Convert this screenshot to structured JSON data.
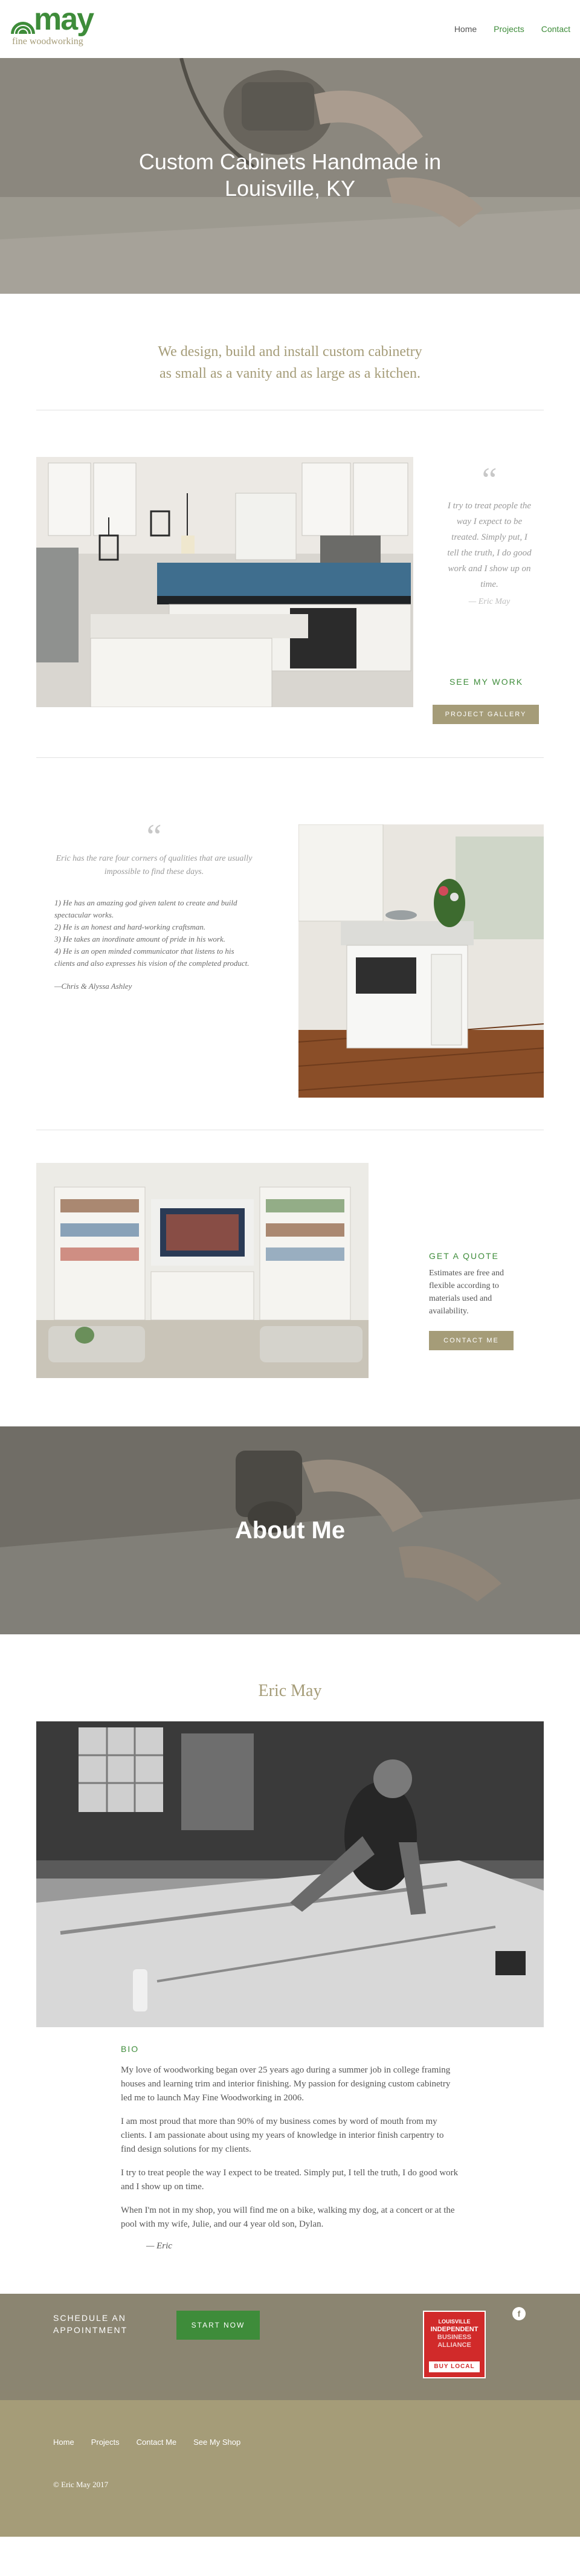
{
  "brand": {
    "name": "may",
    "subtitle": "fine woodworking",
    "green": "#3e8c3a",
    "tan": "#a59c78"
  },
  "nav": {
    "items": [
      {
        "label": "Home",
        "active": false
      },
      {
        "label": "Projects",
        "active": true
      },
      {
        "label": "Contact",
        "active": true
      }
    ]
  },
  "hero": {
    "title_line1": "Custom Cabinets Handmade in",
    "title_line2": "Louisville, KY"
  },
  "tagline": {
    "line1": "We design, build and install custom cabinetry",
    "line2": "as small as a vanity and as large as a kitchen."
  },
  "section1": {
    "quote_mark": "“",
    "quote": "I try to treat people the way I expect to be treated. Simply put, I tell the truth, I do good work and I show up on time.",
    "cite": "— Eric May",
    "link": "SEE MY WORK",
    "button": "PROJECT GALLERY"
  },
  "section2": {
    "quote_mark": "“",
    "intro": "Eric has the rare four corners of qualities that are usually impossible to find these days.",
    "points": [
      "1) He has an amazing god given talent to create and build spectacular works.",
      "2) He is an honest and hard-working craftsman.",
      "3) He takes an inordinate amount of pride in his work.",
      "4) He is an open minded communicator that listens to his clients and also expresses his vision of the completed product."
    ],
    "cite": "—Chris & Alyssa Ashley"
  },
  "section3": {
    "heading": "GET A QUOTE",
    "text": "Estimates are free and flexible according to materials used and availability.",
    "button": "CONTACT ME"
  },
  "about": {
    "banner_title": "About Me",
    "name": "Eric May",
    "bio_label": "BIO",
    "paragraphs": [
      "My love of woodworking began over 25 years ago during a summer job in college framing houses and learning trim and interior finishing.   My passion for designing custom cabinetry led me to launch May Fine Woodworking in 2006.",
      "I am most proud that more than 90% of my business comes by word of mouth from my clients.  I am passionate about using my years of knowledge in interior finish carpentry to find design solutions for my clients.",
      "I try to treat people the way I expect to be treated.  Simply put, I tell the truth, I do good work and I show up on time.",
      "When I'm not in my shop, you will find me on a bike, walking my dog, at a concert or at the pool with my wife, Julie, and our 4 year old son, Dylan."
    ],
    "signature": "— Eric"
  },
  "footer": {
    "schedule_line1": "SCHEDULE AN",
    "schedule_line2": "APPOINTMENT",
    "start_button": "START NOW",
    "facebook_glyph": "f",
    "badge": {
      "line1": "LOUISVILLE",
      "line2": "INDEPENDENT",
      "line3": "BUSINESS",
      "line4": "ALLIANCE",
      "bottom": "BUY LOCAL"
    },
    "links": [
      "Home",
      "Projects",
      "Contact Me",
      "See My Shop"
    ],
    "copyright": "© Eric May 2017"
  }
}
